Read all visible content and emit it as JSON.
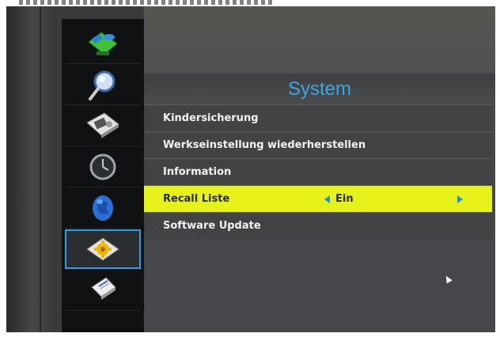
{
  "screen": {
    "title": "System"
  },
  "sidebar": {
    "items": [
      {
        "icon": "satellite-dish-icon"
      },
      {
        "icon": "magnifier-icon"
      },
      {
        "icon": "media-player-icon"
      },
      {
        "icon": "clock-icon"
      },
      {
        "icon": "globe-icon"
      },
      {
        "icon": "settings-gear-icon",
        "active": true
      },
      {
        "icon": "document-icon"
      }
    ]
  },
  "menu": {
    "items": [
      {
        "label": "Kindersicherung"
      },
      {
        "label": "Werkseinstellung wiederherstellen"
      },
      {
        "label": "Information"
      },
      {
        "label": "Recall Liste",
        "value": "Ein",
        "selected": true
      },
      {
        "label": "Software Update"
      }
    ]
  },
  "colors": {
    "accent_blue": "#3aa6e4",
    "selection_yellow": "#e7f21a",
    "sidebar_bg": "#101112",
    "menu_bg": "#424345"
  }
}
